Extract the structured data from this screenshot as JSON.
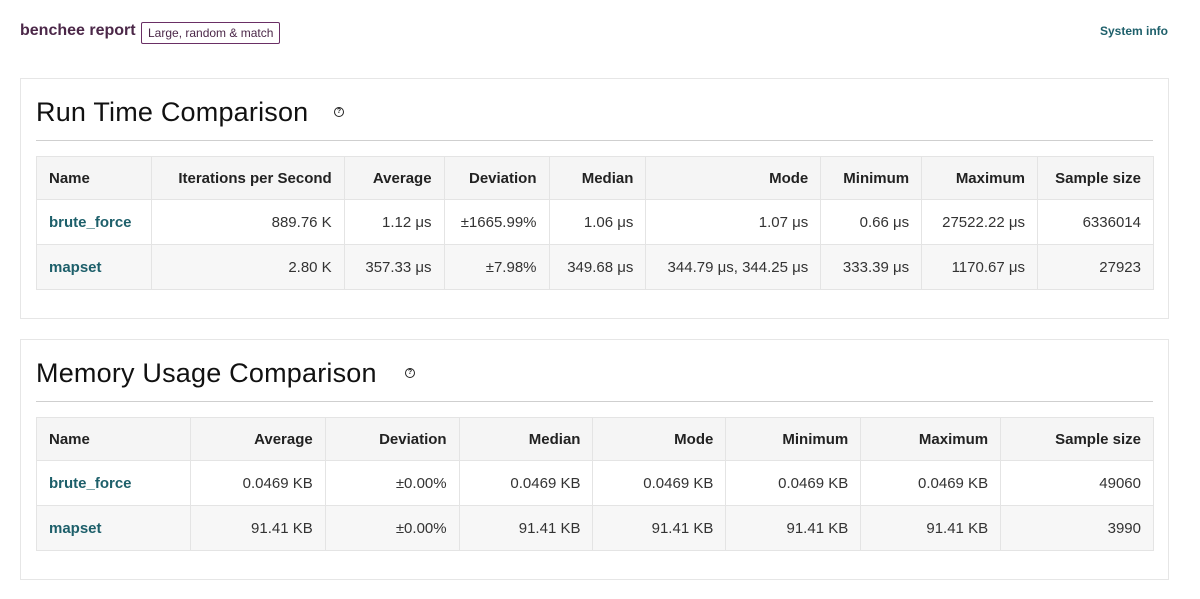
{
  "header": {
    "brand": "benchee report",
    "badge": "Large, random & match",
    "system_info": "System info"
  },
  "run_time": {
    "title": "Run Time Comparison",
    "help": "?",
    "columns": [
      "Name",
      "Iterations per Second",
      "Average",
      "Deviation",
      "Median",
      "Mode",
      "Minimum",
      "Maximum",
      "Sample size"
    ],
    "rows": [
      [
        "brute_force",
        "889.76 K",
        "1.12 μs",
        "±1665.99%",
        "1.06 μs",
        "1.07 μs",
        "0.66 μs",
        "27522.22 μs",
        "6336014"
      ],
      [
        "mapset",
        "2.80 K",
        "357.33 μs",
        "±7.98%",
        "349.68 μs",
        "344.79 μs, 344.25 μs",
        "333.39 μs",
        "1170.67 μs",
        "27923"
      ]
    ]
  },
  "memory": {
    "title": "Memory Usage Comparison",
    "help": "?",
    "columns": [
      "Name",
      "Average",
      "Deviation",
      "Median",
      "Mode",
      "Minimum",
      "Maximum",
      "Sample size"
    ],
    "rows": [
      [
        "brute_force",
        "0.0469 KB",
        "±0.00%",
        "0.0469 KB",
        "0.0469 KB",
        "0.0469 KB",
        "0.0469 KB",
        "49060"
      ],
      [
        "mapset",
        "91.41 KB",
        "±0.00%",
        "91.41 KB",
        "91.41 KB",
        "91.41 KB",
        "91.41 KB",
        "3990"
      ]
    ]
  }
}
